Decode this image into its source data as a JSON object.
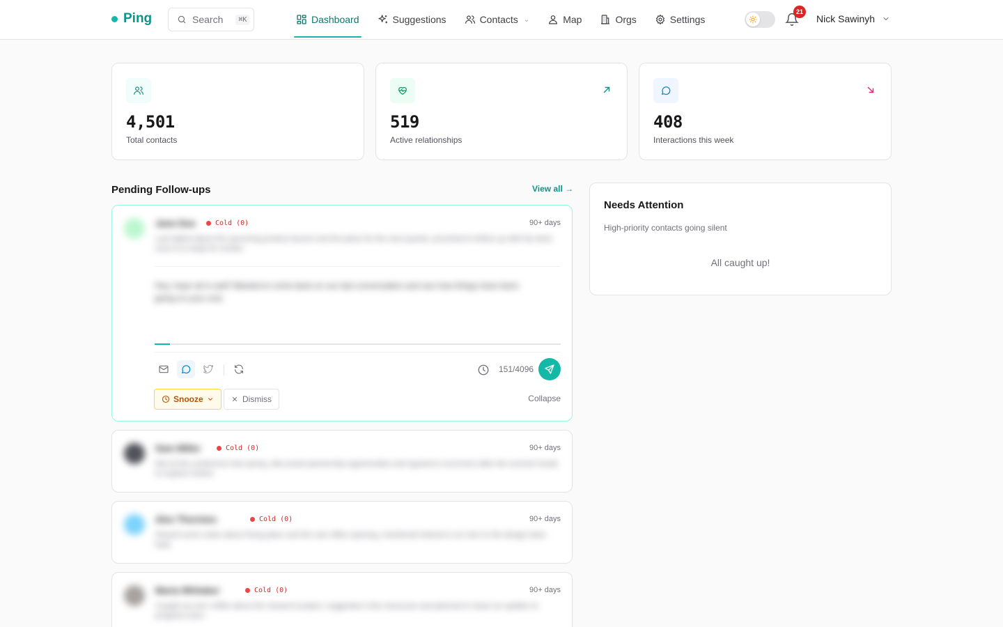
{
  "app": {
    "name": "Ping",
    "accent": "#14b8a6"
  },
  "search": {
    "label": "Search",
    "shortcut": "⌘K"
  },
  "nav": [
    {
      "label": "Dashboard",
      "icon": "dashboard-icon",
      "active": true
    },
    {
      "label": "Suggestions",
      "icon": "sparkles-icon"
    },
    {
      "label": "Contacts",
      "icon": "users-icon",
      "has_dropdown": true
    },
    {
      "label": "Map",
      "icon": "map-pin-icon"
    },
    {
      "label": "Orgs",
      "icon": "building-icon"
    },
    {
      "label": "Settings",
      "icon": "gear-icon"
    }
  ],
  "header": {
    "notifications_count": "21",
    "user_name": "Nick Sawinyh",
    "theme": "light"
  },
  "stats": [
    {
      "value": "4,501",
      "label": "Total contacts",
      "icon": "users-icon",
      "trend": "none"
    },
    {
      "value": "519",
      "label": "Active relationships",
      "icon": "heart-pulse-icon",
      "trend": "up"
    },
    {
      "value": "408",
      "label": "Interactions this week",
      "icon": "message-circle-icon",
      "trend": "down"
    }
  ],
  "followups": {
    "title": "Pending Follow-ups",
    "view_all": "View all →",
    "items": [
      {
        "name": "Jane Doe",
        "status": "Cold (0)",
        "age": "90+ days",
        "snippet": "Last talked about the upcoming product launch and the plans for the next quarter, promised to follow up with the deck once it is ready for review.",
        "expanded": true,
        "draft": "Hey, hope all is well! Wanted to circle back on our last conversation and see how things have been going on your end.",
        "draft_progress": 0.037,
        "char_count": "151/4096",
        "snooze_label": "Snooze",
        "dismiss_label": "Dismiss",
        "collapse_label": "Collapse"
      },
      {
        "name": "Sam Miller",
        "status": "Cold (0)",
        "age": "90+ days",
        "snippet": "Met at the conference last spring, discussed partnership opportunities and agreed to reconnect after the summer break to explore further."
      },
      {
        "name": "Alex Thornton",
        "status": "Cold (0)",
        "age": "90+ days",
        "snippet": "Shared some notes about hiring plans and the new office opening, mentioned interest in an intro to the design team lead."
      },
      {
        "name": "Maria Whitaker",
        "status": "Cold (0)",
        "age": "90+ days",
        "snippet": "Caught up over coffee about the research project, suggested a few resources and planned to share an update on progress soon."
      }
    ]
  },
  "attention": {
    "title": "Needs Attention",
    "subtitle": "High-priority contacts going silent",
    "empty": "All caught up!"
  }
}
